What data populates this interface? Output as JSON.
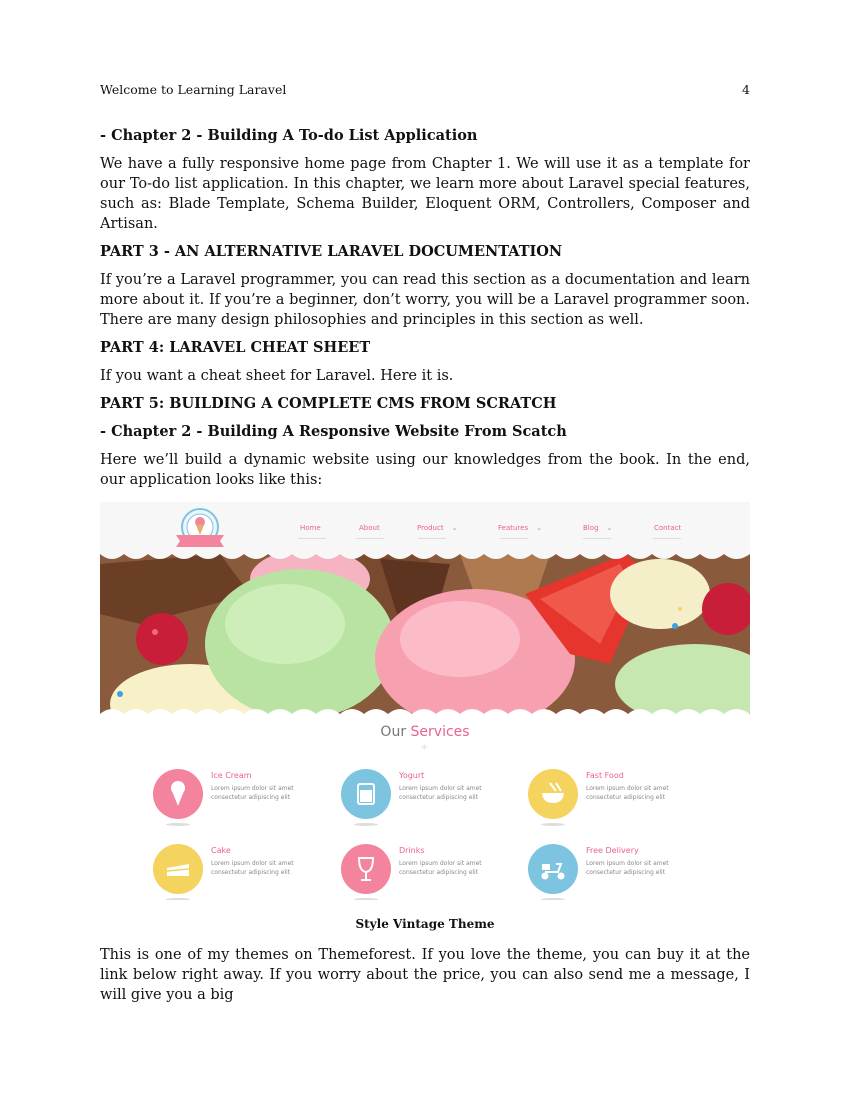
{
  "header": {
    "running_title": "Welcome to Learning Laravel",
    "page_number": "4"
  },
  "blocks": [
    {
      "kind": "heading",
      "text": "- Chapter 2 - Building A To-do List Application"
    },
    {
      "kind": "para",
      "text": "We have a fully responsive home page from Chapter 1. We will use it as a template for our To-do list application. In this chapter, we learn more about Laravel special features, such as: Blade Template, Schema Builder, Eloquent ORM, Controllers, Composer and Artisan."
    },
    {
      "kind": "heading",
      "text": "PART 3 - AN ALTERNATIVE LARAVEL DOCUMENTATION"
    },
    {
      "kind": "para",
      "text": "If you’re a Laravel programmer, you can read this section as a documentation and learn more about it. If you’re a beginner, don’t worry, you will be a Laravel programmer soon. There are many design philosophies and principles in this section as well."
    },
    {
      "kind": "heading",
      "text": "PART 4: LARAVEL CHEAT SHEET"
    },
    {
      "kind": "para",
      "text": "If you want a cheat sheet for Laravel. Here it is."
    },
    {
      "kind": "heading",
      "text": "PART 5: BUILDING A COMPLETE CMS FROM SCRATCH"
    },
    {
      "kind": "heading",
      "text": "- Chapter 2 - Building A Responsive Website From Scatch"
    },
    {
      "kind": "para",
      "text": "Here we’ll build a dynamic website using our knowledges from the book. In the end, our application looks like this:"
    }
  ],
  "screenshot": {
    "nav_items": [
      "Home",
      "About",
      "Product",
      "Features",
      "Blog",
      "Contact"
    ],
    "services_title_plain": "Our ",
    "services_title_accent": "Services",
    "services": [
      {
        "label": "Ice Cream",
        "desc": "Lorem ipsum dolor sit amet consectetur adipiscing elit",
        "color": "#f4849e",
        "label_color": "#e8638a",
        "icon": "ice-cream-icon"
      },
      {
        "label": "Yogurt",
        "desc": "Lorem ipsum dolor sit amet consectetur adipiscing elit",
        "color": "#7cc4e0",
        "label_color": "#e8638a",
        "icon": "yogurt-cup-icon"
      },
      {
        "label": "Fast Food",
        "desc": "Lorem ipsum dolor sit amet consectetur adipiscing elit",
        "color": "#f4d35e",
        "label_color": "#e8638a",
        "icon": "bowl-icon"
      },
      {
        "label": "Cake",
        "desc": "Lorem ipsum dolor sit amet consectetur adipiscing elit",
        "color": "#f4d35e",
        "label_color": "#e8638a",
        "icon": "cake-icon"
      },
      {
        "label": "Drinks",
        "desc": "Lorem ipsum dolor sit amet consectetur adipiscing elit",
        "color": "#f4849e",
        "label_color": "#e8638a",
        "icon": "wine-glass-icon"
      },
      {
        "label": "Free Delivery",
        "desc": "Lorem ipsum dolor sit amet consectetur adipiscing elit",
        "color": "#7cc4e0",
        "label_color": "#e8638a",
        "icon": "scooter-icon"
      }
    ]
  },
  "caption": "Style Vintage Theme",
  "closing_para": "This is one of my themes on Themeforest. If you love the theme, you can buy it at the link below right away. If you worry about the price, you can also send me a message, I will give you a big"
}
